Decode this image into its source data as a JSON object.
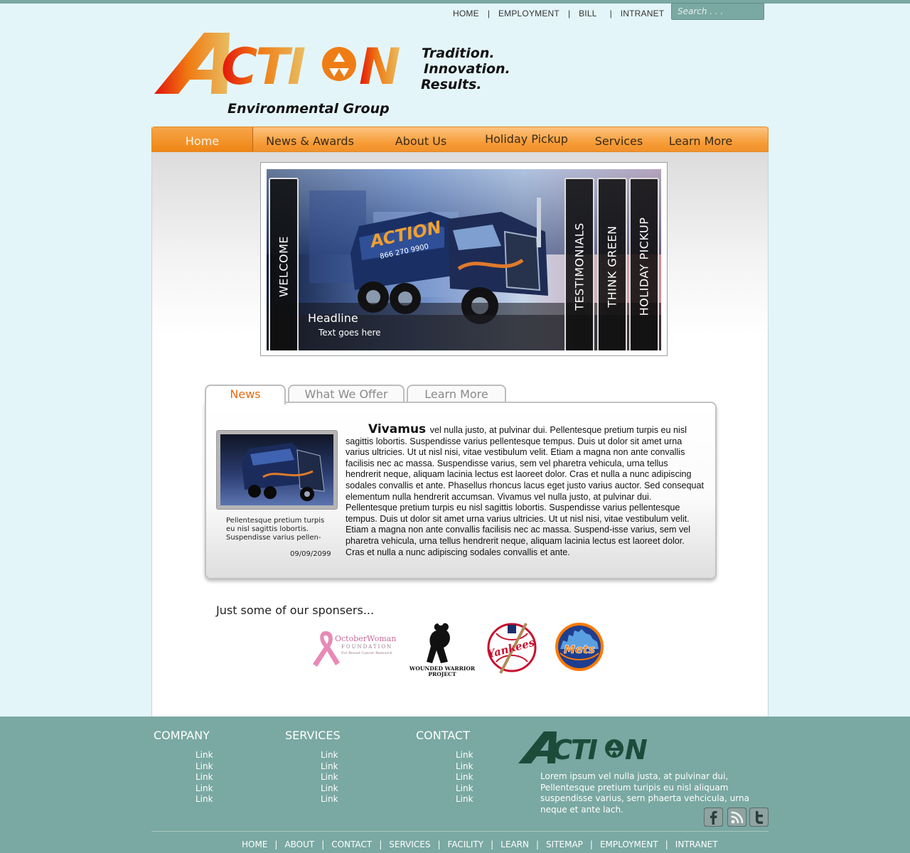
{
  "top_nav": {
    "items": [
      "HOME",
      "EMPLOYMENT",
      "BILL",
      "INTRANET"
    ],
    "separator": "|"
  },
  "search": {
    "placeholder": "Search . . ."
  },
  "brand": {
    "logo_text": "ACTION",
    "subtitle": "Environmental Group",
    "tagline": [
      "Tradition.",
      "Innovation.",
      "Results."
    ],
    "colors": {
      "orange": "#f08a1f",
      "red": "#e3130c",
      "gold": "#e8b84a",
      "teal": "#7aa8a2"
    }
  },
  "main_nav": {
    "items": [
      {
        "label": "Home",
        "active": true
      },
      {
        "label": "News & Awards",
        "active": false
      },
      {
        "label": "About Us",
        "active": false
      },
      {
        "label": "Holiday Pickup",
        "active": false
      },
      {
        "label": "Services",
        "active": false
      },
      {
        "label": "Learn More",
        "active": false
      }
    ]
  },
  "slider": {
    "headline": "Headline",
    "text": "Text goes here",
    "left_tab": "WELCOME",
    "right_tabs": [
      "TESTIMONIALS",
      "THINK GREEN",
      "HOLIDAY PICKUP"
    ],
    "truck_text": "ACTION",
    "truck_phone": "866 270 9900"
  },
  "content_tabs": {
    "items": [
      {
        "label": "News",
        "active": true
      },
      {
        "label": "What We Offer",
        "active": false
      },
      {
        "label": "Learn More",
        "active": false
      }
    ]
  },
  "news": {
    "thumb_caption": "Pellentesque pretium turpis eu nisl sagittis lobortis. Suspendisse varius pellen-",
    "date": "09/09/2099",
    "lead": "Vivamus",
    "body": "vel nulla justo, at pulvinar dui. Pellentesque pretium turpis eu nisl sagittis lobortis. Suspendisse varius pellentesque tempus. Duis ut dolor sit amet urna varius ultricies. Ut ut nisl nisi, vitae vestibulum velit. Etiam a magna non ante convallis facilisis nec ac massa. Suspendisse varius, sem vel pharetra vehicula, urna tellus hendrerit neque, aliquam lacinia lectus est laoreet dolor. Cras et nulla a nunc adipiscing sodales convallis et ante. Phasellus rhoncus lacus eget justo varius auctor. Sed consequat elementum nulla hendrerit accumsan. Vivamus vel nulla justo, at pulvinar dui. Pellentesque pretium turpis eu nisl sagittis lobortis. Suspendisse varius pellentesque tempus. Duis ut dolor sit amet urna varius ultricies. Ut ut nisl nisi, vitae vestibulum velit. Etiam a magna non ante convallis facilisis nec ac massa. Suspend-isse varius, sem vel pharetra vehicula, urna tellus hendrerit neque, aliquam lacinia lectus est laoreet dolor. Cras et nulla a nunc adipiscing sodales convallis et ante."
  },
  "sponsors": {
    "title": "Just some of our sponsers...",
    "october_woman": {
      "name": "OctoberWoman",
      "line2": "FOUNDATION",
      "line3": "For Breast Cancer Research"
    },
    "wounded_warrior": {
      "line1": "WOUNDED WARRIOR",
      "line2": "PROJECT"
    },
    "yankees": "Yankees",
    "mets": "Mets"
  },
  "footer": {
    "columns": [
      {
        "title": "COMPANY",
        "links": [
          "Link",
          "Link",
          "Link",
          "Link",
          "Link"
        ]
      },
      {
        "title": "SERVICES",
        "links": [
          "Link",
          "Link",
          "Link",
          "Link",
          "Link"
        ]
      },
      {
        "title": "CONTACT",
        "links": [
          "Link",
          "Link",
          "Link",
          "Link",
          "Link"
        ]
      }
    ],
    "logo_text": "ACTION",
    "about": "Lorem ipsum vel nulla justa, at pulvinar dui, Pellentesque pretium turipis eu nisl aliquam suspendisse varius, sern phaerta vehcicula, urna neque et ante lach.",
    "social": [
      "facebook-icon",
      "rss-icon",
      "twitter-icon"
    ],
    "bottom_nav": [
      "HOME",
      "ABOUT",
      "CONTACT",
      "SERVICES",
      "FACILITY",
      "LEARN",
      "SITEMAP",
      "EMPLOYMENT",
      "INTRANET"
    ]
  }
}
